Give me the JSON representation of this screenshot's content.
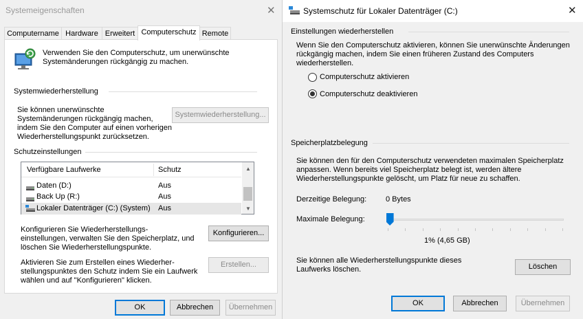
{
  "left_dialog": {
    "title": "Systemeigenschaften",
    "tabs": [
      "Computername",
      "Hardware",
      "Erweitert",
      "Computerschutz",
      "Remote"
    ],
    "intro_line1": "Verwenden Sie den Computerschutz, um unerwünschte",
    "intro_line2": "Systemänderungen rückgängig zu machen.",
    "restore_heading": "Systemwiederherstellung",
    "restore_text": [
      "Sie können unerwünschte",
      "Systemänderungen rückgängig machen,",
      "indem Sie den Computer auf einen vorherigen",
      "Wiederherstellungspunkt zurücksetzen."
    ],
    "restore_button": "Systemwiederherstellung...",
    "protection_heading": "Schutzeinstellungen",
    "table_headers": [
      "Verfügbare Laufwerke",
      "Schutz"
    ],
    "drives": [
      {
        "name": "Daten (D:)",
        "status": "Aus"
      },
      {
        "name": "Back Up (R:)",
        "status": "Aus"
      },
      {
        "name": "Lokaler Datenträger (C:) (System)",
        "status": "Aus"
      }
    ],
    "configure_text": [
      "Konfigurieren Sie Wiederherstellungs-",
      "einstellungen, verwalten Sie den Speicherplatz, und",
      "löschen Sie Wiederherstellungspunkte."
    ],
    "configure_button": "Konfigurieren...",
    "create_text": [
      "Aktivieren Sie zum Erstellen eines Wiederher-",
      "stellungspunktes den Schutz indem Sie ein Laufwerk",
      "wählen und auf \"Konfigurieren\" klicken."
    ],
    "create_button": "Erstellen...",
    "ok": "OK",
    "cancel": "Abbrechen",
    "apply": "Übernehmen"
  },
  "right_dialog": {
    "title": "Systemschutz für Lokaler Datenträger (C:)",
    "restore_heading": "Einstellungen wiederherstellen",
    "restore_text": [
      "Wenn Sie den Computerschutz aktivieren, können Sie unerwünschte Änderungen",
      "rückgängig machen, indem Sie einen früheren Zustand des Computers",
      "wiederherstellen."
    ],
    "radio_enable": "Computerschutz aktivieren",
    "radio_disable": "Computerschutz deaktivieren",
    "selected_option": "Computerschutz deaktivieren",
    "storage_heading": "Speicherplatzbelegung",
    "storage_text": [
      "Sie können den für den Computerschutz verwendeten maximalen Speicherplatz",
      "anpassen. Wenn bereits viel Speicherplatz belegt ist, werden ältere",
      "Wiederherstellungspunkte gelöscht, um Platz für neue zu schaffen."
    ],
    "current_label": "Derzeitige Belegung:",
    "current_value": "0 Bytes",
    "max_label": "Maximale Belegung:",
    "max_value_label": "1% (4,65 GB)",
    "max_percent": 1,
    "delete_text": [
      "Sie können alle Wiederherstellungspunkte dieses",
      "Laufwerks löschen."
    ],
    "delete_button": "Löschen",
    "ok": "OK",
    "cancel": "Abbrechen",
    "apply": "Übernehmen"
  },
  "colors": {
    "accent": "#0078d7",
    "dialog_bg": "#f0f0f0",
    "disabled_text": "#8a8a8a"
  }
}
